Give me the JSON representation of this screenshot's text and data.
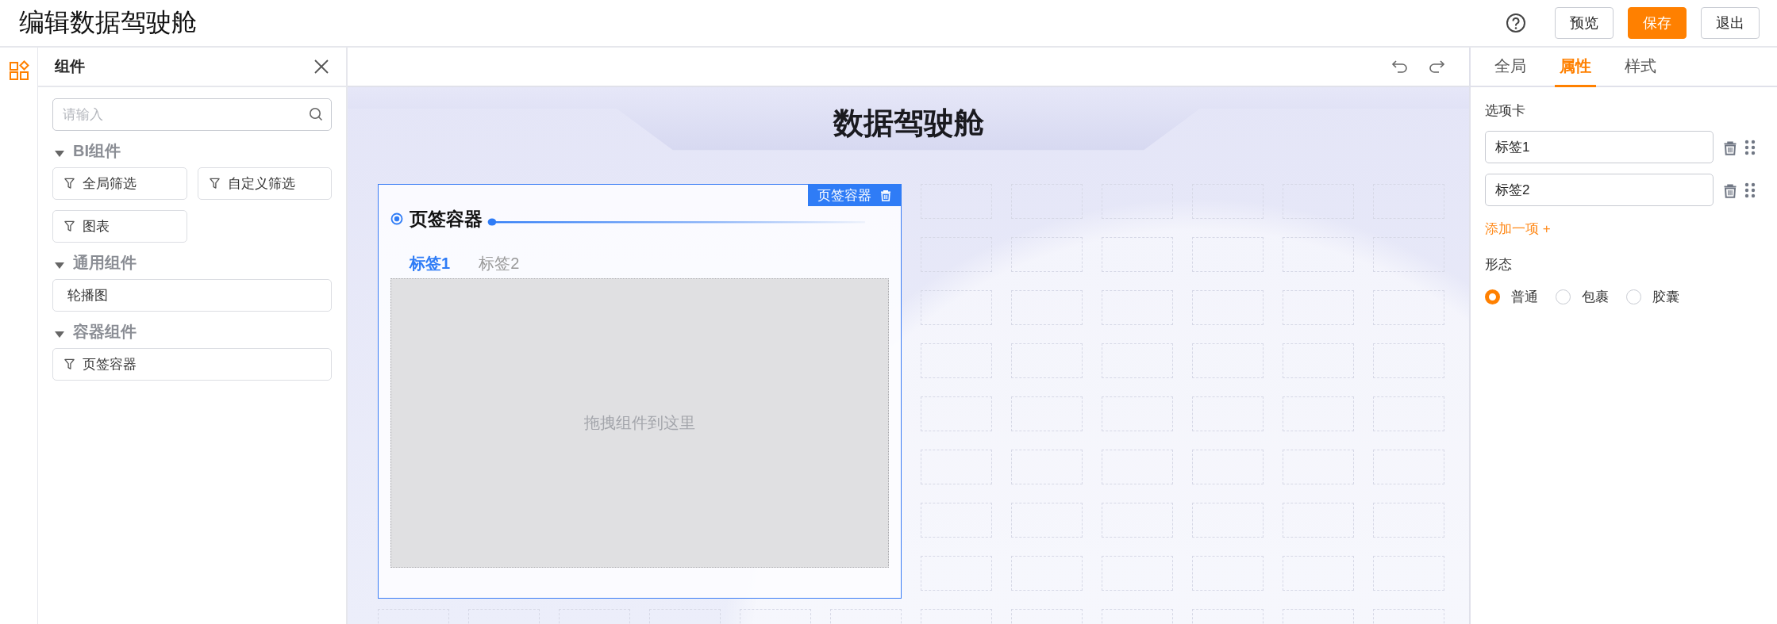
{
  "header": {
    "title": "编辑数据驾驶舱",
    "buttons": [
      {
        "label": "预览",
        "kind": "default"
      },
      {
        "label": "保存",
        "kind": "primary"
      },
      {
        "label": "退出",
        "kind": "default"
      }
    ]
  },
  "sidebar_rail": [
    {
      "selected": true
    }
  ],
  "component_panel": {
    "title": "组件",
    "search": {
      "placeholder": "请输入"
    },
    "groups": [
      {
        "title": "BI组件",
        "expanded": true,
        "kind": "grid",
        "items": [
          {
            "label": "全局筛选",
            "kind": "filter"
          },
          {
            "label": "自定义筛选",
            "kind": "filter"
          },
          {
            "label": "图表",
            "kind": "filter"
          }
        ]
      },
      {
        "title": "通用组件",
        "expanded": true,
        "kind": "list",
        "items": [
          {
            "label": "轮播图",
            "kind": "plain"
          }
        ]
      },
      {
        "title": "容器组件",
        "expanded": true,
        "kind": "list",
        "items": [
          {
            "label": "页签容器",
            "kind": "filter"
          }
        ]
      }
    ]
  },
  "canvas": {
    "title": "数据驾驶舱",
    "container": {
      "selected": true,
      "tag": "页签容器",
      "title": "页签容器",
      "tabs": [
        {
          "label": "标签1",
          "selected": true
        },
        {
          "label": "标签2",
          "selected": false
        }
      ],
      "drop_hint": "拖拽组件到这里"
    }
  },
  "properties_panel": {
    "tabs": [
      {
        "label": "全局",
        "selected": false
      },
      {
        "label": "属性",
        "selected": true
      },
      {
        "label": "样式",
        "selected": false
      }
    ],
    "tabs_section": {
      "label": "选项卡",
      "items": [
        {
          "value": "标签1"
        },
        {
          "value": "标签2"
        }
      ],
      "add_link": "添加一项 +"
    },
    "shape": {
      "label": "形态",
      "options": [
        {
          "label": "普通",
          "selected": true
        },
        {
          "label": "包裹",
          "selected": false
        },
        {
          "label": "胶囊",
          "selected": false
        }
      ]
    }
  }
}
